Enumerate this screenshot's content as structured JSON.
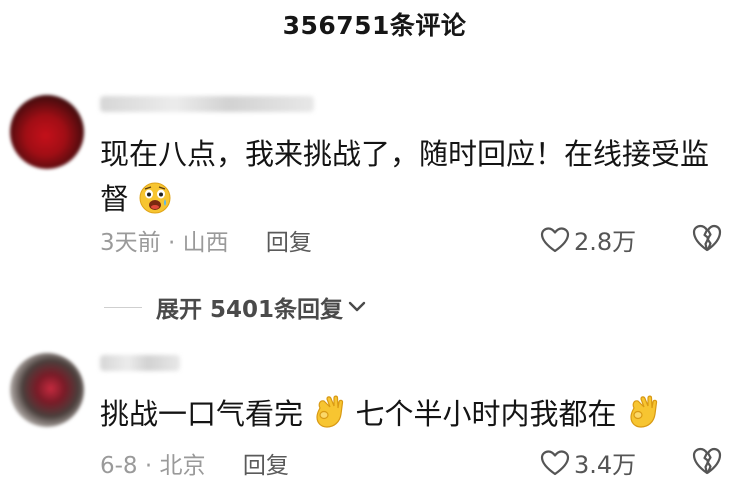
{
  "header": {
    "title": "356751条评论"
  },
  "comments": [
    {
      "text": "现在八点，我来挑战了，随时回应！在线接受监督",
      "emoji": "scream-face-icon",
      "meta": "3天前 · 山西",
      "reply_label": "回复",
      "likes": "2.8万"
    },
    {
      "text_part1": "挑战一口气看完",
      "text_part2": " 七个半小时内我都在",
      "emoji": "ok-hand-icon",
      "meta": "6-8 · 北京",
      "reply_label": "回复",
      "likes": "3.4万"
    }
  ],
  "expand": {
    "label": "展开 5401条回复"
  },
  "colors": {
    "text": "#141414",
    "meta": "#9a9a9a",
    "reply": "#5a5a5a",
    "background": "#ffffff"
  }
}
